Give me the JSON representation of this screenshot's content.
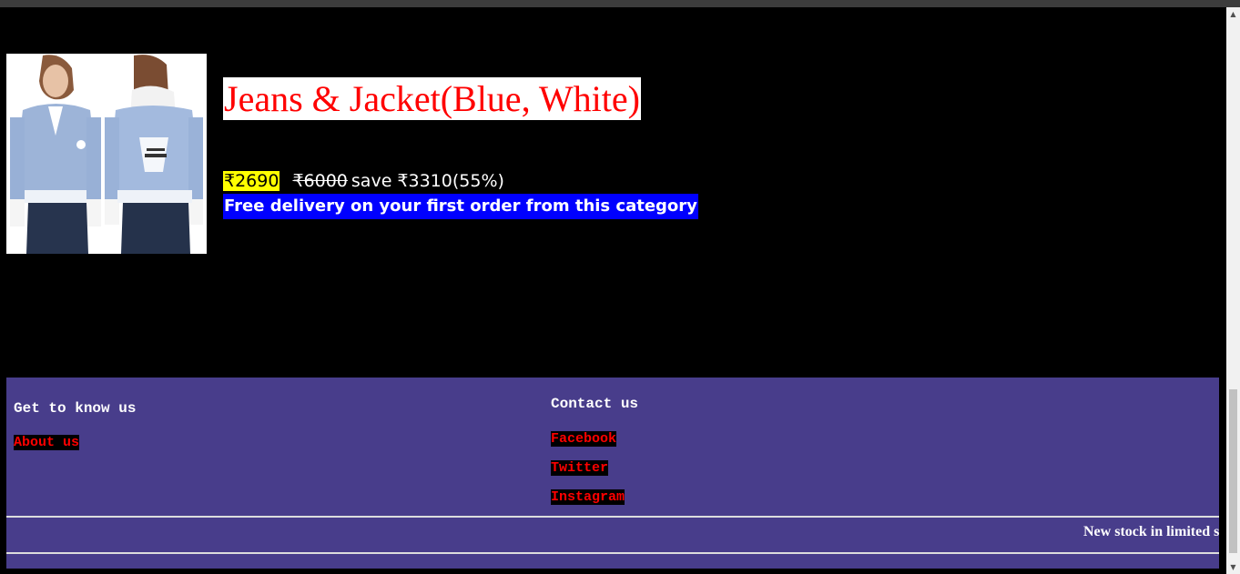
{
  "product": {
    "title": "Jeans & Jacket(Blue, White)",
    "price": "₹2690",
    "old_price": "₹6000",
    "save_text": "save ₹3310(55%)",
    "delivery_text": "Free delivery on your first order from this category"
  },
  "footer": {
    "col1": {
      "heading": "Get to know us",
      "links": [
        "About us"
      ]
    },
    "col2": {
      "heading": "Contact us",
      "links": [
        "Facebook",
        "Twitter",
        "Instagram"
      ]
    },
    "marquee_text": "New stock in limited s"
  },
  "colors": {
    "background": "#000000",
    "title_text": "#ff0000",
    "price_highlight": "#ffff00",
    "delivery_bg": "#0000ff",
    "footer_bg": "#483d8b",
    "link_text": "#ff0000"
  }
}
